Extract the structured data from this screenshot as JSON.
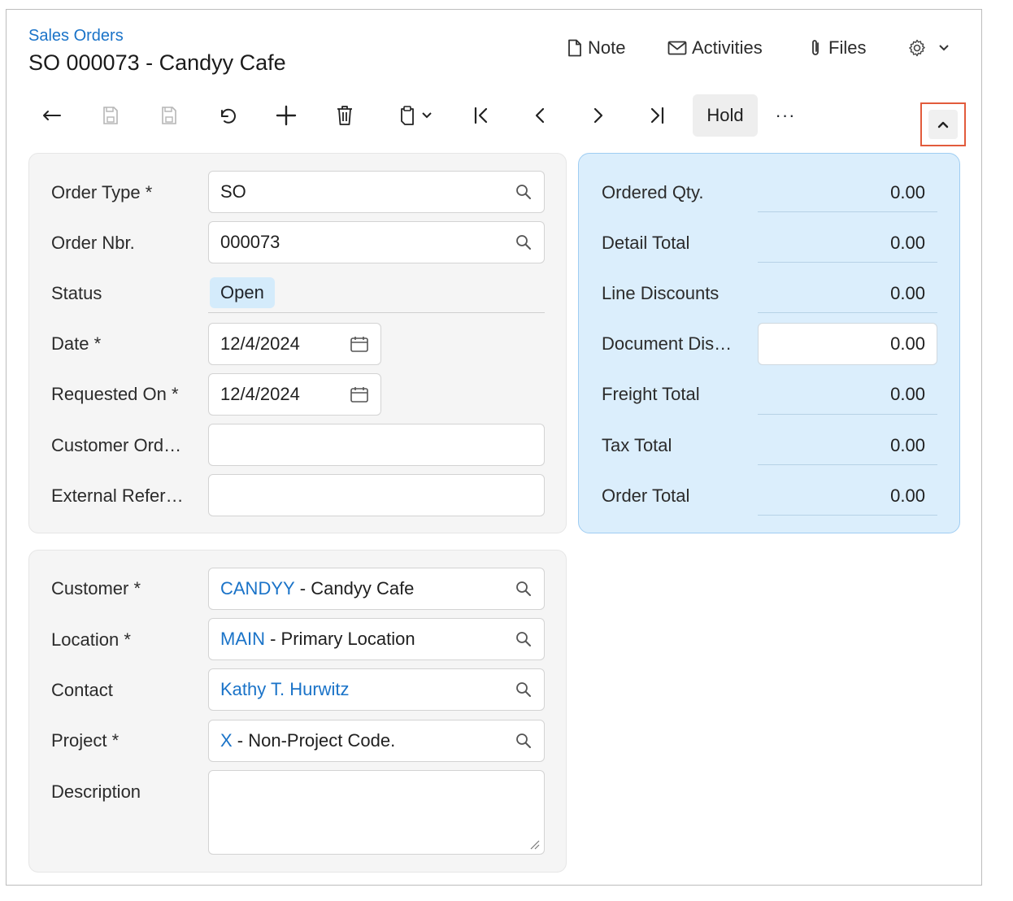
{
  "header": {
    "breadcrumb": "Sales Orders",
    "title": "SO 000073 - Candyy Cafe",
    "actions": {
      "note": "Note",
      "activities": "Activities",
      "files": "Files"
    }
  },
  "toolbar": {
    "hold_label": "Hold",
    "more_label": "···"
  },
  "order": {
    "order_type_label": "Order Type",
    "order_type_value": "SO",
    "order_nbr_label": "Order Nbr.",
    "order_nbr_value": "000073",
    "status_label": "Status",
    "status_value": "Open",
    "date_label": "Date",
    "date_value": "12/4/2024",
    "requested_on_label": "Requested On",
    "requested_on_value": "12/4/2024",
    "customer_ord_label": "Customer Ord…",
    "external_ref_label": "External Refer…",
    "required_mark": "*"
  },
  "customer": {
    "customer_label": "Customer",
    "customer_code": "CANDYY",
    "customer_name": " - Candyy Cafe",
    "location_label": "Location",
    "location_code": "MAIN",
    "location_name": " - Primary Location",
    "contact_label": "Contact",
    "contact_value": "Kathy T. Hurwitz",
    "project_label": "Project",
    "project_code": "X",
    "project_name": " - Non-Project Code.",
    "description_label": "Description"
  },
  "summary": {
    "ordered_qty_label": "Ordered Qty.",
    "ordered_qty": "0.00",
    "detail_total_label": "Detail Total",
    "detail_total": "0.00",
    "line_discounts_label": "Line Discounts",
    "line_discounts": "0.00",
    "document_dis_label": "Document Dis…",
    "document_dis": "0.00",
    "freight_total_label": "Freight Total",
    "freight_total": "0.00",
    "tax_total_label": "Tax Total",
    "tax_total": "0.00",
    "order_total_label": "Order Total",
    "order_total": "0.00"
  }
}
